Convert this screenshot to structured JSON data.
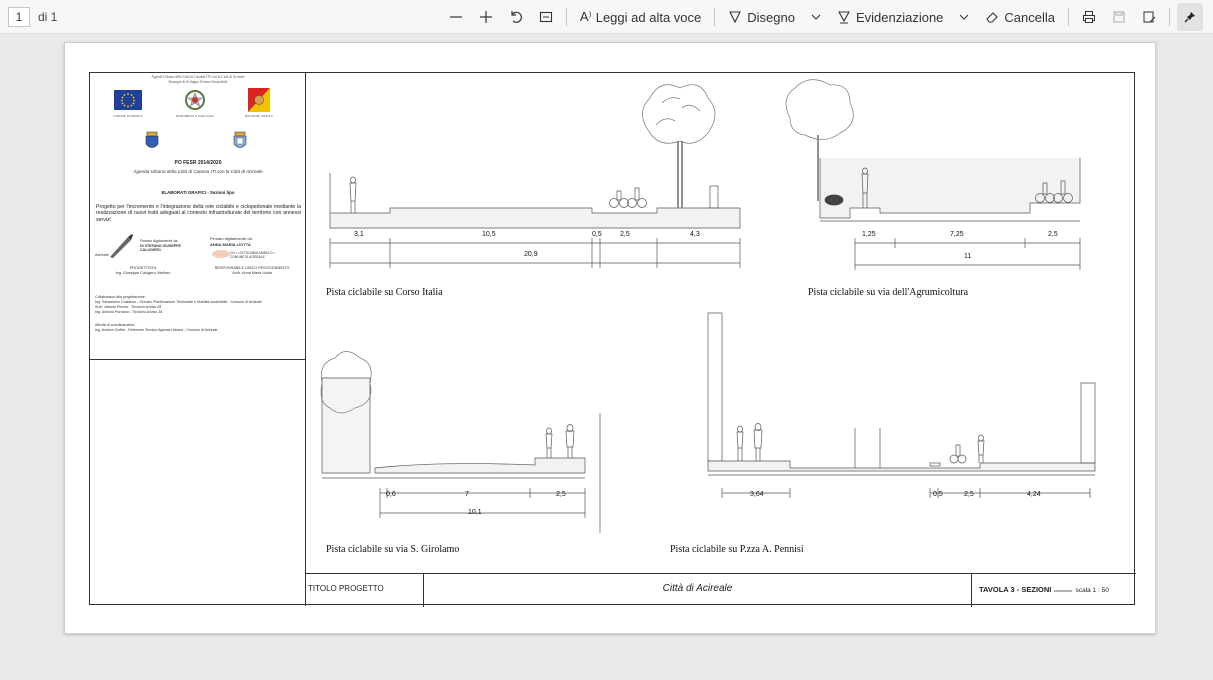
{
  "toolbar": {
    "page_number": "1",
    "page_of": "di 1",
    "read_aloud": "Leggi ad alta voce",
    "draw": "Disegno",
    "highlight": "Evidenziazione",
    "erase": "Cancella"
  },
  "document": {
    "header_line1": "Agenda Urbana della Città di Catania ITI con la Città di Acireale",
    "header_line2": "Strategia di Sviluppo Urbano Sostenibile",
    "eu_caption": "UNIONE EUROPEA",
    "it_caption": "REPUBBLICA ITALIANA",
    "si_caption": "REGIONE SICILIA",
    "program": "PO FESR 2014/2020",
    "agenda": "Agenda Urbana della Città di Catania ITI con la Città di Acireale",
    "elaborati": "ELABORATI GRAFICI  -  Sezioni tipo",
    "project_desc": "Progetto per l'incremento e l'integrazione della rete ciclabile e ciclopedonale mediante la realizzazione di nuovi tratti adeguati al contesto infrastrutturale del territorio con annessi servizi",
    "sign_left_label": "Firmato digitalmente da",
    "sign_left_name": "DI STEFANO GIUSEPPE CALOGERO",
    "sign_right_label": "Firmato digitalmente da",
    "sign_right_name": "ANNA MARIA LIOTTA",
    "sign_right_detail": "CN = LIOTTA ANNA MARIA O = COMUNE DI ACIREALE",
    "acireale_word": "Acireale",
    "progettista_title": "PROGETTISTA",
    "progettista_name": "Ing. Giuseppe Calogero Vitellaro",
    "rup_title": "RESPONSABILE UNICO PROCEDIMENTO",
    "rup_name": "Arch. Anna Maria Liotta",
    "collab_title": "Collaboratori alla progettazione:",
    "collab_1": "Ing. Sebastiano Costanzo  -  Servizio Pianificazione Territoriale e Mobilità sostenibile  -  Comune di Acireale",
    "collab_2": "Arch. Alessia Pirrone  -  Tirocinio Avviso 28",
    "collab_3": "Ing. Antonio Purrazzo  -  Tirocinio Avviso 28",
    "coord_title": "Attività di coordinamento:",
    "coord_1": "Ing. Andrea Giuffrè  -  Referente Tecnico Agenda Urbana  -  Comune di Acireale",
    "captions": {
      "corso_italia": "Pista ciclabile su Corso Italia",
      "agrumicoltura": "Pista ciclabile su via dell'Agrumicoltura",
      "girolamo": "Pista ciclabile su via S. Girolamo",
      "pennisi": "Pista ciclabile su P.zza A. Pennisi"
    },
    "dims": {
      "ci_1": "3,1",
      "ci_2": "10,5",
      "ci_3": "0,5",
      "ci_4": "2,5",
      "ci_5": "4,3",
      "ci_total": "20,9",
      "ag_1": "1,25",
      "ag_2": "7,25",
      "ag_3": "2,5",
      "ag_total": "11",
      "gi_1": "0,6",
      "gi_2": "7",
      "gi_3": "2,5",
      "gi_total": "10,1",
      "pe_1": "3,64",
      "pe_2": "0,5",
      "pe_3": "2,5",
      "pe_4": "4,24"
    },
    "titolo_progetto": "TITOLO PROGETTO",
    "citta": "Città di Acireale",
    "tavola": "TAVOLA 3 - SEZIONI",
    "scala": "scala 1 : 50"
  }
}
